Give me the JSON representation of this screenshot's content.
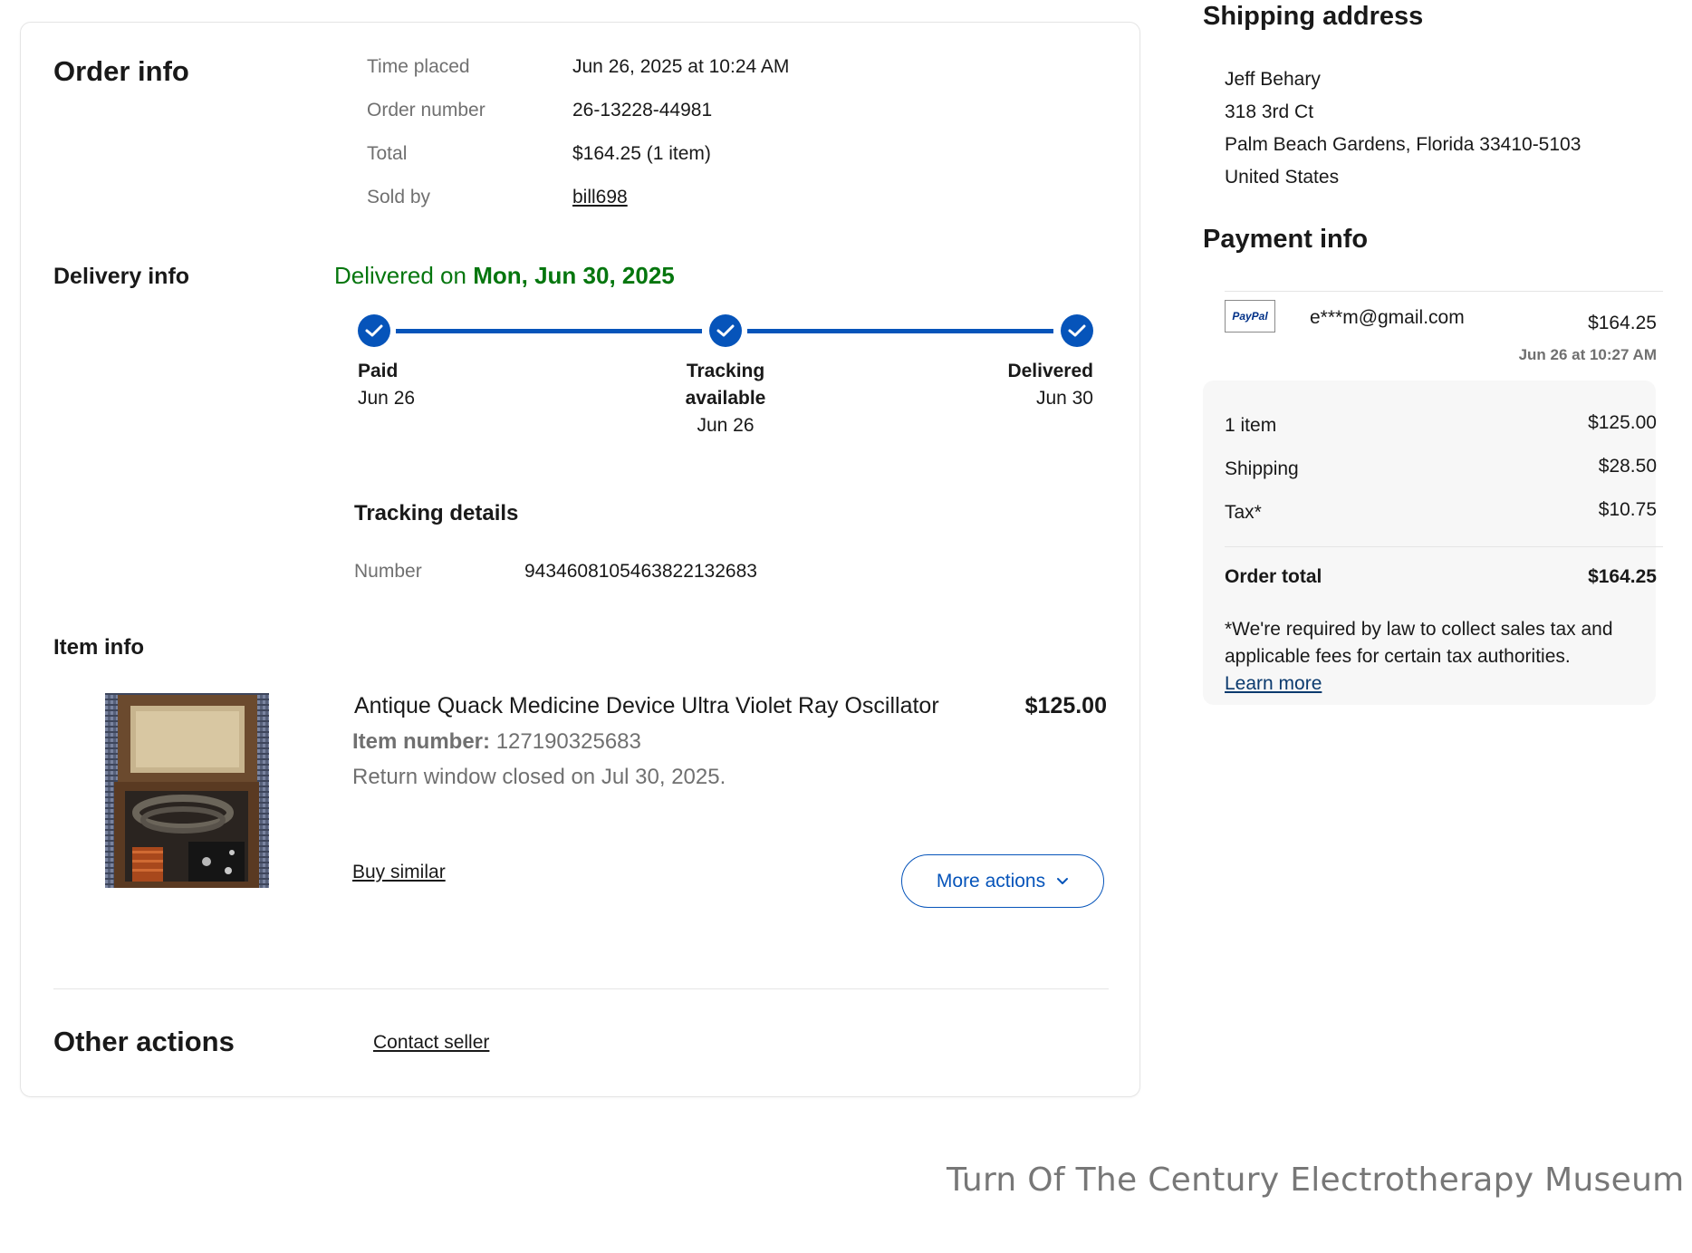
{
  "order_info": {
    "title": "Order info",
    "time_placed_label": "Time placed",
    "time_placed_value": "Jun 26, 2025 at 10:24 AM",
    "order_number_label": "Order number",
    "order_number_value": "26-13228-44981",
    "total_label": "Total",
    "total_value": "$164.25 (1 item)",
    "sold_by_label": "Sold by",
    "sold_by_value": "bill698"
  },
  "delivery_info": {
    "title": "Delivery info",
    "delivered_prefix": "Delivered on",
    "delivered_date": "Mon, Jun 30, 2025",
    "steps": [
      {
        "label": "Paid",
        "date": "Jun 26"
      },
      {
        "label_line1": "Tracking",
        "label_line2": "available",
        "date": "Jun 26"
      },
      {
        "label": "Delivered",
        "date": "Jun 30"
      }
    ],
    "tracking_details_title": "Tracking details",
    "tracking_number_label": "Number",
    "tracking_number_value": "9434608105463822132683"
  },
  "item_info": {
    "title": "Item info",
    "item_title": "Antique Quack Medicine Device Ultra Violet Ray Oscillator",
    "price": "$125.00",
    "item_number_label": "Item number:",
    "item_number_value": "127190325683",
    "return_window": "Return window closed on Jul 30, 2025.",
    "buy_similar": "Buy similar",
    "more_actions": "More actions"
  },
  "other_actions": {
    "title": "Other actions",
    "contact_seller": "Contact seller"
  },
  "shipping_address": {
    "title": "Shipping address",
    "lines": [
      "Jeff Behary",
      "318 3rd Ct",
      "Palm Beach Gardens, Florida 33410-5103",
      "United States"
    ]
  },
  "payment_info": {
    "title": "Payment info",
    "paypal_logo_text": "PayPal",
    "email": "e***m@gmail.com",
    "amount": "$164.25",
    "timestamp": "Jun 26 at 10:27 AM"
  },
  "summary": {
    "items_label": "1 item",
    "items_value": "$125.00",
    "shipping_label": "Shipping",
    "shipping_value": "$28.50",
    "tax_label": "Tax*",
    "tax_value": "$10.75",
    "order_total_label": "Order total",
    "order_total_value": "$164.25",
    "tax_note": "*We're required by law to collect sales tax and applicable fees for certain tax authorities.",
    "learn_more": "Learn more"
  },
  "footer_text": "Turn Of The Century Electrotherapy Museum",
  "colors": {
    "accent_blue": "#0654ba",
    "delivered_green": "#05760e",
    "muted_text": "#707070"
  }
}
